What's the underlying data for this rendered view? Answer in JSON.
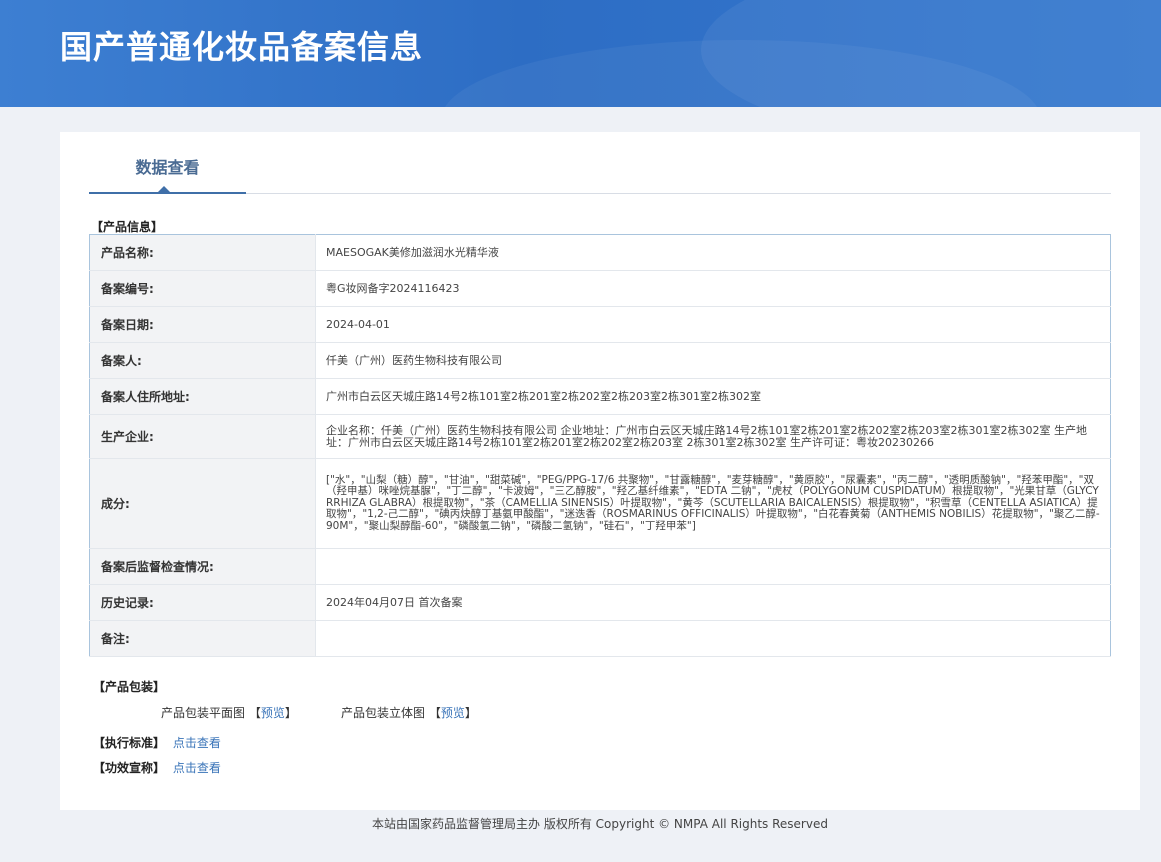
{
  "header": {
    "title": "国产普通化妆品备案信息"
  },
  "tabs": [
    {
      "label": "数据查看"
    }
  ],
  "product_info": {
    "section_label": "【产品信息】",
    "rows": [
      {
        "key": "产品名称:",
        "value": "MAESOGAK美修加滋润水光精华液"
      },
      {
        "key": "备案编号:",
        "value": "粤G妆网备字2024116423"
      },
      {
        "key": "备案日期:",
        "value": "2024-04-01"
      },
      {
        "key": "备案人:",
        "value": "仟美（广州）医药生物科技有限公司"
      },
      {
        "key": "备案人住所地址:",
        "value": "广州市白云区天城庄路14号2栋101室2栋201室2栋202室2栋203室2栋301室2栋302室"
      },
      {
        "key": "生产企业:",
        "value": "企业名称：仟美（广州）医药生物科技有限公司 企业地址：广州市白云区天城庄路14号2栋101室2栋201室2栋202室2栋203室2栋301室2栋302室 生产地址：广州市白云区天城庄路14号2栋101室2栋201室2栋202室2栋203室 2栋301室2栋302室 生产许可证：粤妆20230266"
      },
      {
        "key": "成分:",
        "value": "[\"水\"，\"山梨（糖）醇\"，\"甘油\"，\"甜菜碱\"，\"PEG/PPG-17/6 共聚物\"，\"甘露糖醇\"，\"麦芽糖醇\"，\"黄原胶\"，\"尿囊素\"，\"丙二醇\"，\"透明质酸钠\"，\"羟苯甲酯\"，\"双（羟甲基）咪唑烷基脲\"，\"丁二醇\"，\"卡波姆\"，\"三乙醇胺\"，\"羟乙基纤维素\"，\"EDTA 二钠\"，\"虎杖（POLYGONUM CUSPIDATUM）根提取物\"，\"光果甘草（GLYCYRRHIZA GLABRA）根提取物\"，\"茶（CAMELLIA SINENSIS）叶提取物\"，\"黄芩（SCUTELLARIA BAICALENSIS）根提取物\"，\"积雪草（CENTELLA ASIATICA）提取物\"，\"1,2-己二醇\"，\"碘丙炔醇丁基氨甲酸酯\"，\"迷迭香（ROSMARINUS OFFICINALIS）叶提取物\"，\"白花春黄菊（ANTHEMIS NOBILIS）花提取物\"，\"聚乙二醇-90M\"，\"聚山梨醇酯-60\"，\"磷酸氢二钠\"，\"磷酸二氢钠\"，\"硅石\"，\"丁羟甲苯\"]"
      },
      {
        "key": "备案后监督检查情况:",
        "value": ""
      },
      {
        "key": "历史记录:",
        "value": "2024年04月07日 首次备案"
      },
      {
        "key": "备注:",
        "value": ""
      }
    ]
  },
  "packaging": {
    "section_label": "【产品包装】",
    "flat_label": "产品包装平面图",
    "flat_link": "预览",
    "solid_label": "产品包装立体图",
    "solid_link": "预览"
  },
  "standard": {
    "label": "【执行标准】",
    "link": "点击查看"
  },
  "efficacy": {
    "label": "【功效宣称】",
    "link": "点击查看"
  },
  "footer": {
    "text": "本站由国家药品监督管理局主办 版权所有 Copyright © NMPA All Rights Reserved"
  }
}
